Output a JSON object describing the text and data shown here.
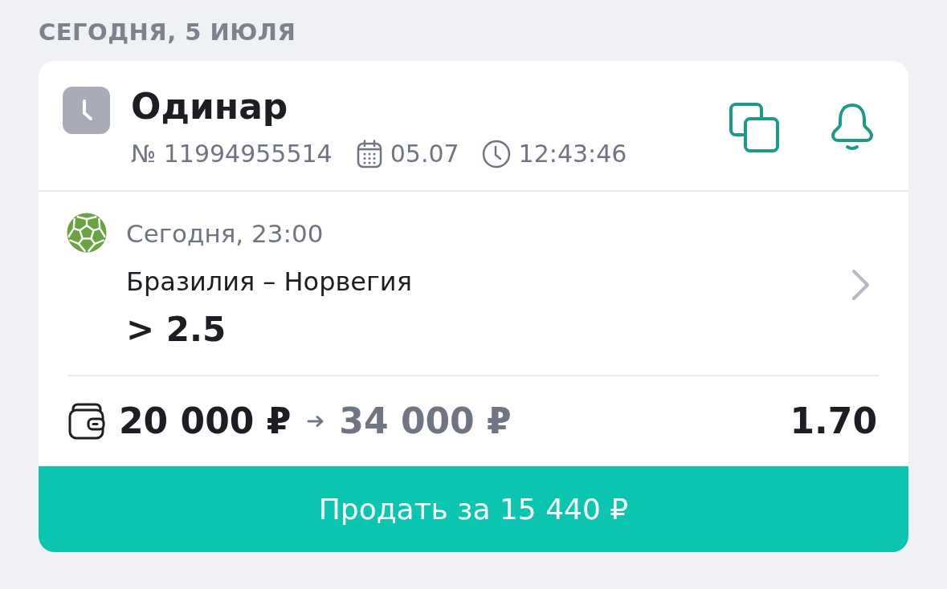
{
  "date_header": "СЕГОДНЯ, 5 ИЮЛЯ",
  "bet": {
    "type": "Одинар",
    "number": "№ 11994955514",
    "date": "05.07",
    "time": "12:43:46",
    "event": {
      "start": "Сегодня, 23:00",
      "match": "Бразилия – Норвегия",
      "outcome": "> 2.5"
    },
    "stake": "20 000 ₽",
    "payout": "34 000 ₽",
    "odds": "1.70",
    "sell_button": "Продать за 15 440 ₽"
  }
}
